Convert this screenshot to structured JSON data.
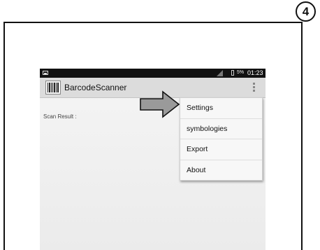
{
  "step": {
    "number": "4"
  },
  "status_bar": {
    "battery": "5%",
    "time": "01:23"
  },
  "app_bar": {
    "title": "BarcodeScanner",
    "icon": "barcode-icon",
    "menu_icon": "overflow-menu-icon"
  },
  "main": {
    "scan_result_label": "Scan Result :"
  },
  "menu": {
    "items": [
      {
        "label": "Settings"
      },
      {
        "label": "symbologies"
      },
      {
        "label": "Export"
      },
      {
        "label": "About"
      }
    ]
  },
  "annotation": {
    "arrow_target": "Settings",
    "arrow_icon": "pointer-arrow-icon"
  }
}
